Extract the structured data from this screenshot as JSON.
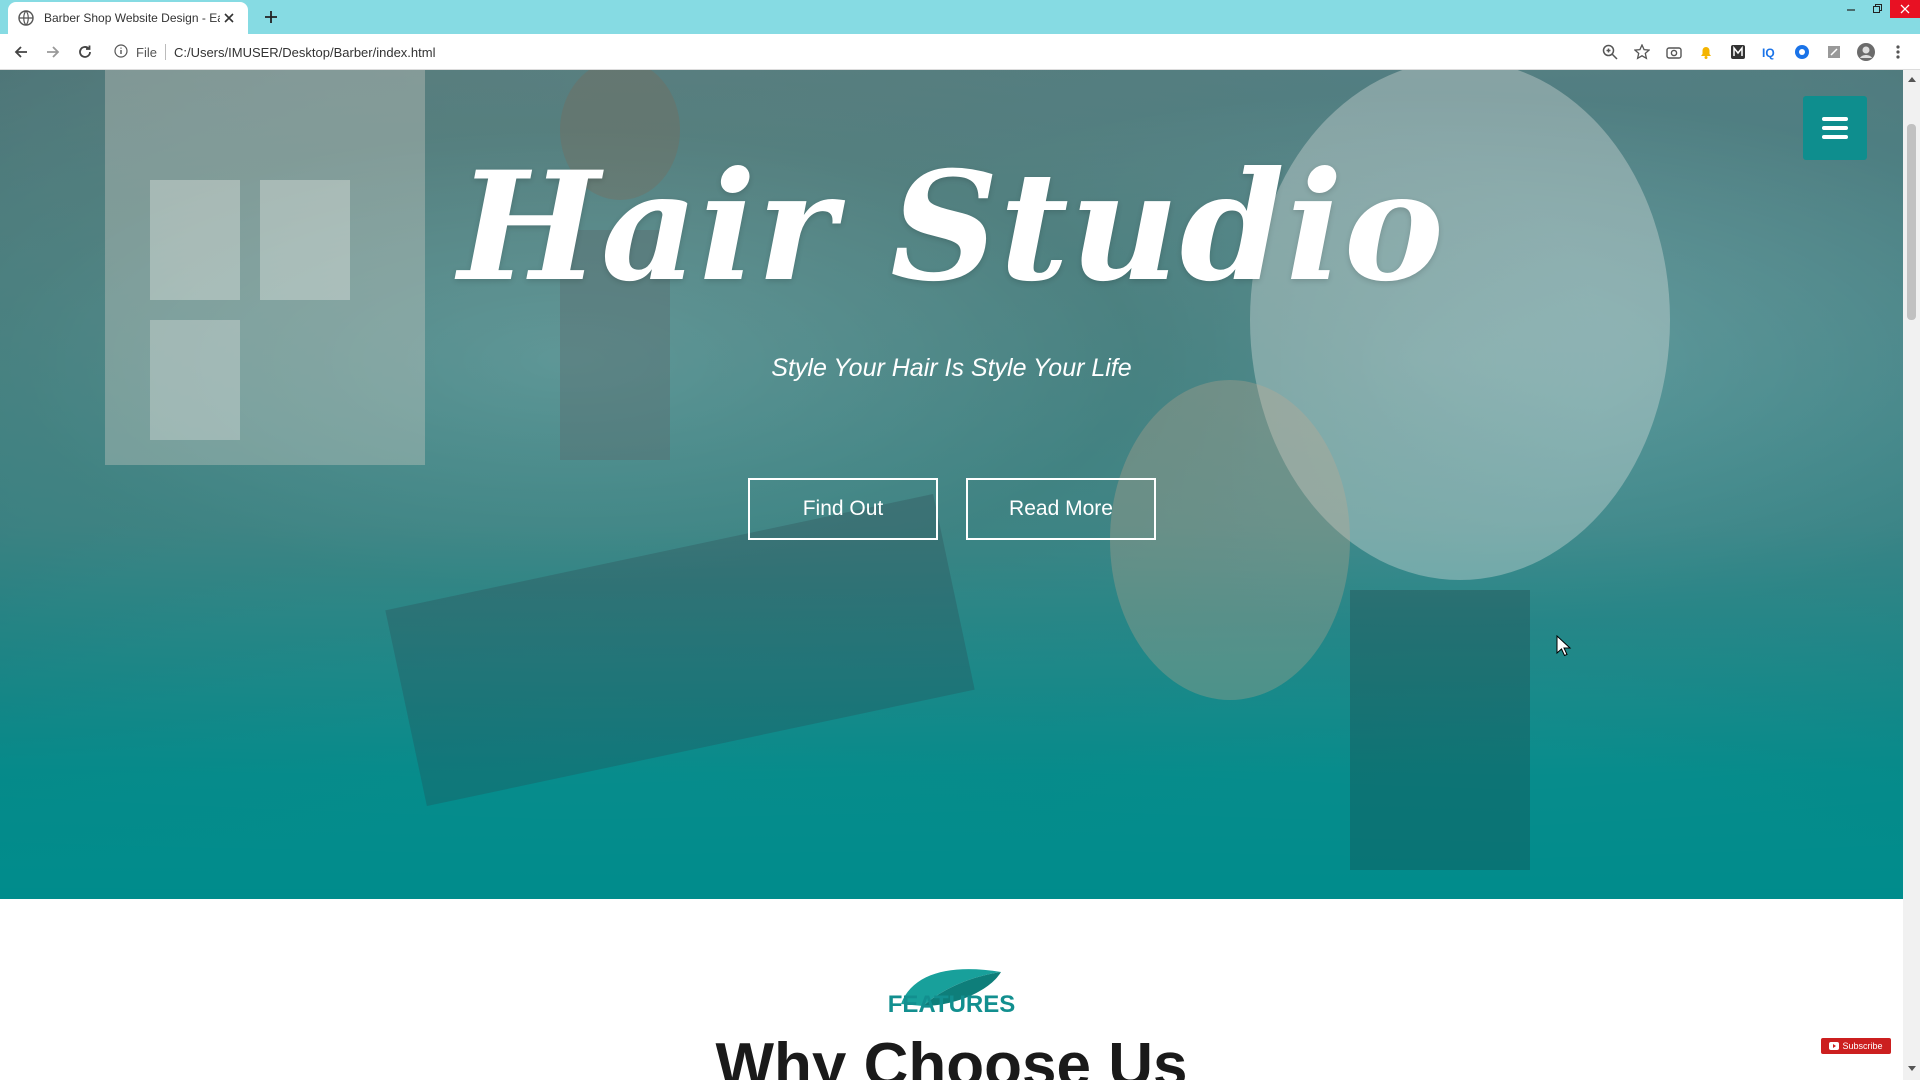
{
  "browser": {
    "tab_title": "Barber Shop Website Design - Ea",
    "url_protocol": "File",
    "url": "C:/Users/IMUSER/Desktop/Barber/index.html",
    "extensions": [
      "zoom-icon",
      "star-icon",
      "camera-icon",
      "bell-extension-icon",
      "m-extension-icon",
      "iq-extension-icon",
      "circle-extension-icon",
      "puzzle-extension-icon",
      "profile-avatar",
      "more-menu-icon"
    ]
  },
  "hero": {
    "title": "Hair Studio",
    "subtitle": "Style Your Hair Is Style Your Life",
    "buttons": [
      "Find Out",
      "Read More"
    ]
  },
  "features": {
    "label": "FEATURES",
    "heading": "Why Choose Us"
  },
  "overlay": {
    "youtube_subscribe": "Subscribe"
  },
  "colors": {
    "accent": "#0e8e8e",
    "tabbar": "#86dbe3",
    "features_text": "#128f8f"
  }
}
